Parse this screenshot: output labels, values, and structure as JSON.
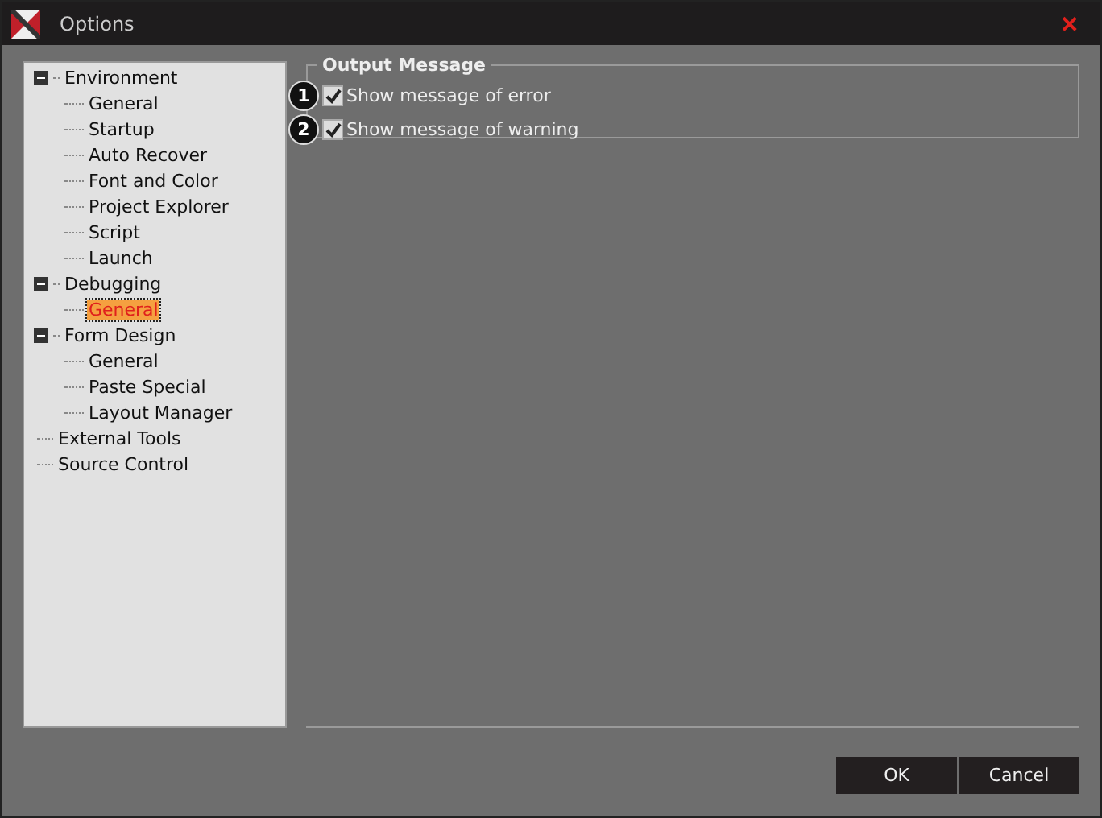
{
  "window": {
    "title": "Options",
    "close": "✕"
  },
  "tree": [
    {
      "label": "Environment",
      "expanded": true,
      "selected": false,
      "children": [
        {
          "label": "General",
          "selected": false
        },
        {
          "label": "Startup",
          "selected": false
        },
        {
          "label": "Auto Recover",
          "selected": false
        },
        {
          "label": "Font and Color",
          "selected": false
        },
        {
          "label": "Project Explorer",
          "selected": false
        },
        {
          "label": "Script",
          "selected": false
        },
        {
          "label": "Launch",
          "selected": false
        }
      ]
    },
    {
      "label": "Debugging",
      "expanded": true,
      "selected": false,
      "children": [
        {
          "label": "General",
          "selected": true
        }
      ]
    },
    {
      "label": "Form Design",
      "expanded": true,
      "selected": false,
      "children": [
        {
          "label": "General",
          "selected": false
        },
        {
          "label": "Paste Special",
          "selected": false
        },
        {
          "label": "Layout Manager",
          "selected": false
        }
      ]
    },
    {
      "label": "External Tools",
      "selected": false
    },
    {
      "label": "Source Control",
      "selected": false
    }
  ],
  "group": {
    "title": "Output Message",
    "options": [
      {
        "badge": "1",
        "label": "Show message of error",
        "checked": true
      },
      {
        "badge": "2",
        "label": "Show message of warning",
        "checked": true
      }
    ]
  },
  "buttons": [
    "OK",
    "Cancel"
  ]
}
